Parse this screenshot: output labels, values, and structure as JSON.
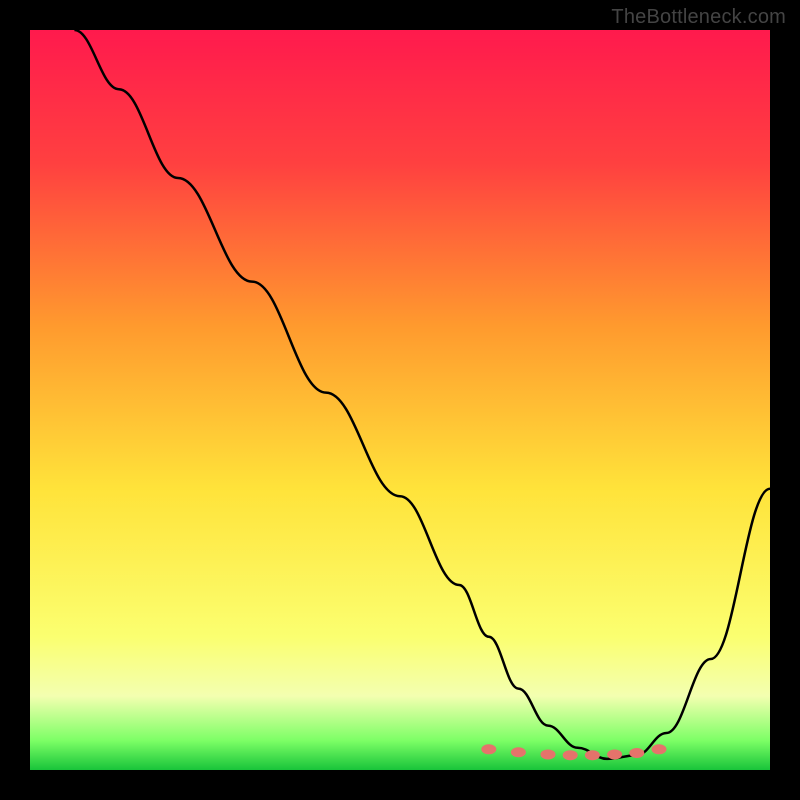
{
  "attribution": "TheBottleneck.com",
  "gradient_stops": [
    {
      "pct": 0,
      "color": "#ff1a4d"
    },
    {
      "pct": 18,
      "color": "#ff4040"
    },
    {
      "pct": 40,
      "color": "#ff9a2e"
    },
    {
      "pct": 62,
      "color": "#ffe33a"
    },
    {
      "pct": 82,
      "color": "#fbff70"
    },
    {
      "pct": 90,
      "color": "#f3ffb0"
    },
    {
      "pct": 96,
      "color": "#7dff66"
    },
    {
      "pct": 100,
      "color": "#18c43a"
    }
  ],
  "chart_data": {
    "type": "line",
    "title": "",
    "xlabel": "",
    "ylabel": "",
    "xlim": [
      0,
      100
    ],
    "ylim": [
      0,
      100
    ],
    "series": [
      {
        "name": "curve",
        "x": [
          6,
          12,
          20,
          30,
          40,
          50,
          58,
          62,
          66,
          70,
          74,
          78,
          82,
          86,
          92,
          100
        ],
        "y": [
          100,
          92,
          80,
          66,
          51,
          37,
          25,
          18,
          11,
          6,
          3,
          1.5,
          2,
          5,
          15,
          38
        ]
      }
    ],
    "minimum_markers": {
      "x": [
        62,
        66,
        70,
        73,
        76,
        79,
        82,
        85
      ],
      "y": [
        2.8,
        2.4,
        2.1,
        2.0,
        2.0,
        2.1,
        2.3,
        2.8
      ]
    },
    "marker_color": "#e5736b",
    "curve_color": "#000000"
  }
}
